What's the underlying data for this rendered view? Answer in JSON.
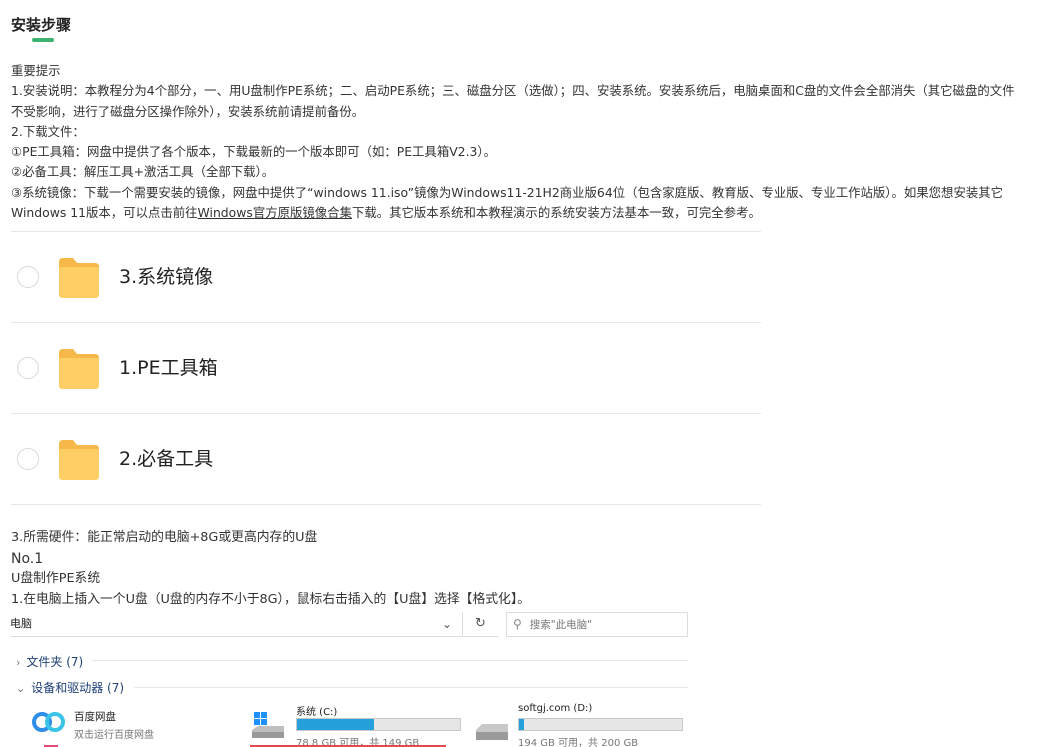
{
  "header": {
    "title": "安装步骤",
    "accent_color": "#3cb371"
  },
  "intro": {
    "line1": "重要提示",
    "line2": "1.安装说明：本教程分为4个部分，一、用U盘制作PE系统；二、启动PE系统；三、磁盘分区（选做）；四、安装系统。安装系统后，电脑桌面和C盘的文件会全部消失（其它磁盘的文件不受影响，进行了磁盘分区操作除外），安装系统前请提前备份。",
    "line3": "2.下载文件：",
    "line4": "①PE工具箱：网盘中提供了各个版本，下载最新的一个版本即可（如：PE工具箱V2.3）。",
    "line5": "②必备工具：解压工具+激活工具（全部下载）。",
    "line6_before": "③系统镜像：下载一个需要安装的镜像，网盘中提供了“windows 11.iso”镜像为Windows11-21H2商业版64位（包含家庭版、教育版、专业版、专业工作站版）。如果您想安装其它Windows 11版本，可以点击前往",
    "line6_link": "Windows官方原版镜像合集",
    "line6_after": "下载。其它版本系统和本教程演示的系统安装方法基本一致，可完全参考。"
  },
  "folders": [
    {
      "label": "3.系统镜像"
    },
    {
      "label": "1.PE工具箱"
    },
    {
      "label": "2.必备工具"
    }
  ],
  "after": {
    "hardware": "3.所需硬件：能正常启动的电脑+8G或更高内存的U盘",
    "no": "No.1",
    "subtitle": "U盘制作PE系统",
    "step1": "1.在电脑上插入一个U盘（U盘的内存不小于8G），鼠标右击插入的【U盘】选择【格式化】。"
  },
  "explorer": {
    "address": "电脑",
    "search_placeholder": "搜索\"此电脑\"",
    "group_folders": "文件夹 (7)",
    "group_devices": "设备和驱动器 (7)",
    "app": {
      "name": "百度网盘",
      "sub": "双击运行百度网盘"
    },
    "drives": [
      {
        "name": "系统 (C:)",
        "size": "78.8 GB 可用，共 149 GB",
        "used_fraction": 0.47
      },
      {
        "name": "softgj.com (D:)",
        "size": "194 GB 可用，共 200 GB",
        "used_fraction": 0.03
      }
    ]
  }
}
